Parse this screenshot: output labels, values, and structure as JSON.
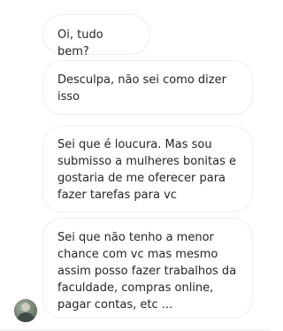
{
  "conversation": {
    "messages": [
      {
        "text": "Oi, tudo bem?"
      },
      {
        "text": "Desculpa, não sei como dizer isso"
      },
      {
        "text": "Sei que é loucura. Mas sou submisso a mulheres bonitas e gostaria de me oferecer para fazer tarefas para vc"
      },
      {
        "text": "Sei que não tenho a menor chance com vc mas mesmo assim posso fazer trabalhos da faculdade, compras online, pagar contas, etc ..."
      }
    ]
  }
}
